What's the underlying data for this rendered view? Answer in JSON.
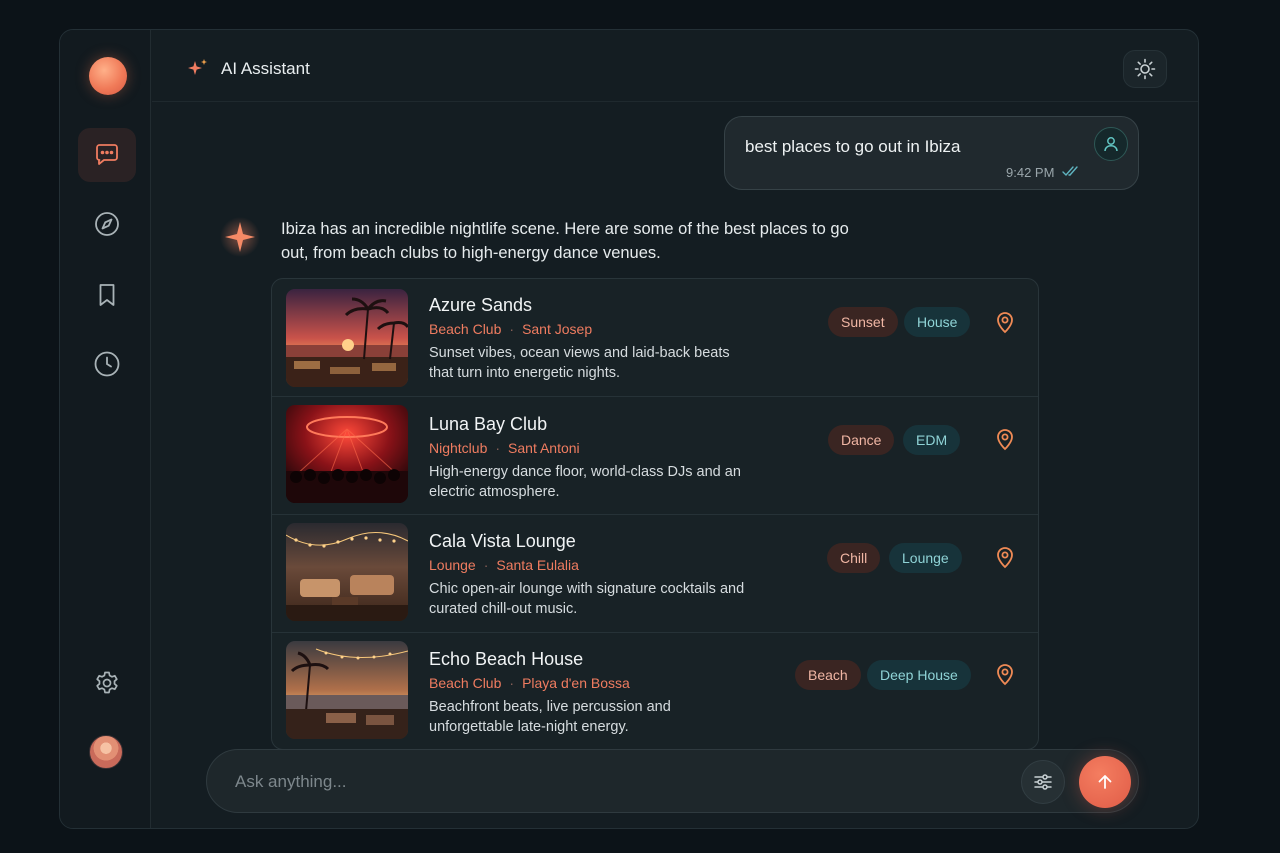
{
  "header": {
    "title": "AI Assistant",
    "theme_icon": "sun-icon"
  },
  "sidebar": {
    "items": [
      {
        "icon": "chat-icon",
        "active": true
      },
      {
        "icon": "compass-icon",
        "active": false
      },
      {
        "icon": "bookmark-icon",
        "active": false
      },
      {
        "icon": "clock-icon",
        "active": false
      }
    ],
    "settings_icon": "gear-icon"
  },
  "conversation": {
    "user_message": {
      "text": "best places to go out in Ibiza",
      "time": "9:42 PM",
      "status_icon": "double-check-icon"
    },
    "assistant_message": {
      "intro": "Ibiza has an incredible nightlife scene. Here are some of the best places to go out, from beach clubs to high-energy dance venues."
    }
  },
  "venues": [
    {
      "name": "Azure Sands",
      "type": "Beach Club",
      "location": "Sant Josep",
      "description": "Sunset vibes, ocean views and laid-back beats that turn into energetic nights.",
      "tags": [
        {
          "label": "Sunset",
          "style": "warm"
        },
        {
          "label": "House",
          "style": "cool"
        }
      ]
    },
    {
      "name": "Luna Bay Club",
      "type": "Nightclub",
      "location": "Sant Antoni",
      "description": "High-energy dance floor, world-class DJs and an electric atmosphere.",
      "tags": [
        {
          "label": "Dance",
          "style": "warm"
        },
        {
          "label": "EDM",
          "style": "cool"
        }
      ]
    },
    {
      "name": "Cala Vista Lounge",
      "type": "Lounge",
      "location": "Santa Eulalia",
      "description": "Chic open-air lounge with signature cocktails and curated chill-out music.",
      "tags": [
        {
          "label": "Chill",
          "style": "warm"
        },
        {
          "label": "Lounge",
          "style": "cool"
        }
      ]
    },
    {
      "name": "Echo Beach House",
      "type": "Beach Club",
      "location": "Playa d'en Bossa",
      "description": "Beachfront beats, live percussion and unforgettable late-night energy.",
      "tags": [
        {
          "label": "Beach",
          "style": "warm"
        },
        {
          "label": "Deep House",
          "style": "cool"
        }
      ]
    }
  ],
  "composer": {
    "placeholder": "Ask anything..."
  },
  "colors": {
    "accent": "#ef7c60",
    "warm_tag_bg": "#3a2522",
    "cool_tag_bg": "#17333a",
    "background": "#141d22"
  }
}
